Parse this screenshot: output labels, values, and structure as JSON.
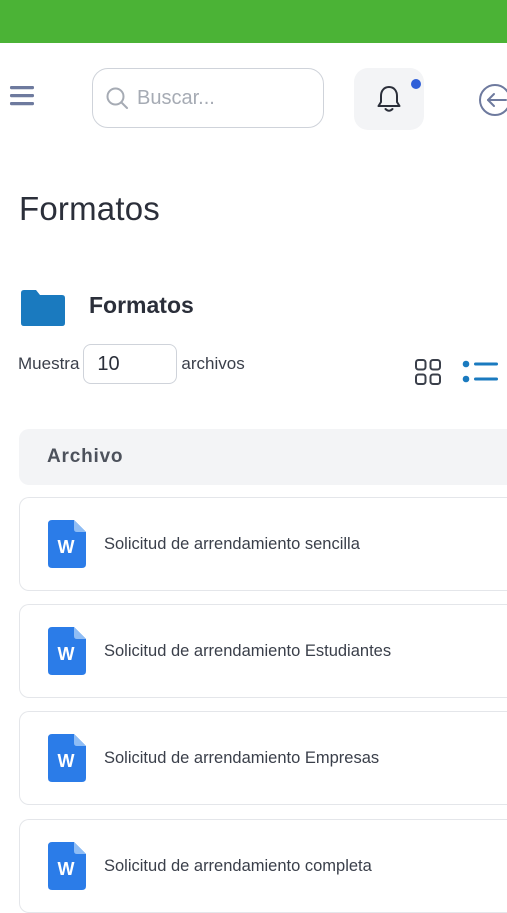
{
  "colors": {
    "top_bar": "#4bb336",
    "accent_blue": "#2f5fd8",
    "folder_blue": "#1a7abf",
    "word_blue": "#2b7ce8",
    "menu_icon": "#6e7a9e"
  },
  "header": {
    "search_placeholder": "Buscar...",
    "icons": [
      "menu-icon",
      "search-icon",
      "bell-icon",
      "back-arrow-icon"
    ]
  },
  "page": {
    "title": "Formatos"
  },
  "folder": {
    "icon": "folder-icon",
    "name": "Formatos"
  },
  "show_control": {
    "prefix": "Muestra",
    "value": "10",
    "suffix": "archivos"
  },
  "view_toggles": [
    "grid-view-icon",
    "list-view-icon"
  ],
  "table": {
    "header": "Archivo",
    "rows": [
      {
        "icon": "word-document-icon",
        "icon_letter": "W",
        "name": "Solicitud de arrendamiento sencilla"
      },
      {
        "icon": "word-document-icon",
        "icon_letter": "W",
        "name": "Solicitud de arrendamiento Estudiantes"
      },
      {
        "icon": "word-document-icon",
        "icon_letter": "W",
        "name": "Solicitud de arrendamiento Empresas"
      },
      {
        "icon": "word-document-icon",
        "icon_letter": "W",
        "name": "Solicitud de arrendamiento completa"
      }
    ]
  }
}
